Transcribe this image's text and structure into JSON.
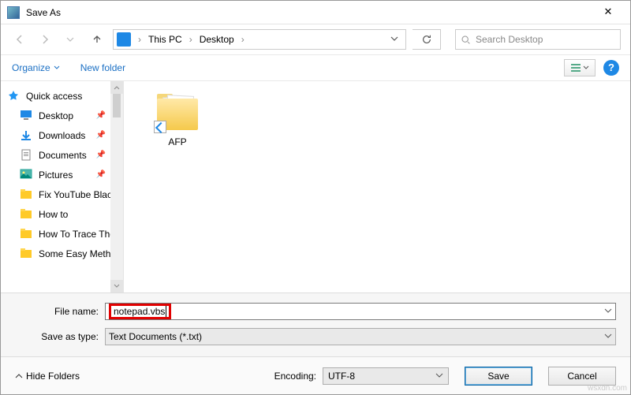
{
  "title": "Save As",
  "nav": {
    "breadcrumb": [
      "This PC",
      "Desktop"
    ],
    "search_placeholder": "Search Desktop"
  },
  "toolbar": {
    "organize": "Organize",
    "new_folder": "New folder"
  },
  "sidebar": {
    "quick_access": "Quick access",
    "items": [
      {
        "label": "Desktop",
        "pinned": true
      },
      {
        "label": "Downloads",
        "pinned": true
      },
      {
        "label": "Documents",
        "pinned": true
      },
      {
        "label": "Pictures",
        "pinned": true
      },
      {
        "label": "Fix YouTube Black",
        "pinned": false
      },
      {
        "label": "How to",
        "pinned": false
      },
      {
        "label": "How To Trace The",
        "pinned": false
      },
      {
        "label": "Some Easy Method",
        "pinned": false
      }
    ]
  },
  "content": {
    "items": [
      {
        "label": "AFP"
      }
    ]
  },
  "form": {
    "file_name_label": "File name:",
    "file_name_value": "notepad.vbs",
    "save_type_label": "Save as type:",
    "save_type_value": "Text Documents (*.txt)"
  },
  "footer": {
    "hide_folders": "Hide Folders",
    "encoding_label": "Encoding:",
    "encoding_value": "UTF-8",
    "save": "Save",
    "cancel": "Cancel"
  },
  "watermark": "wsxdn.com"
}
